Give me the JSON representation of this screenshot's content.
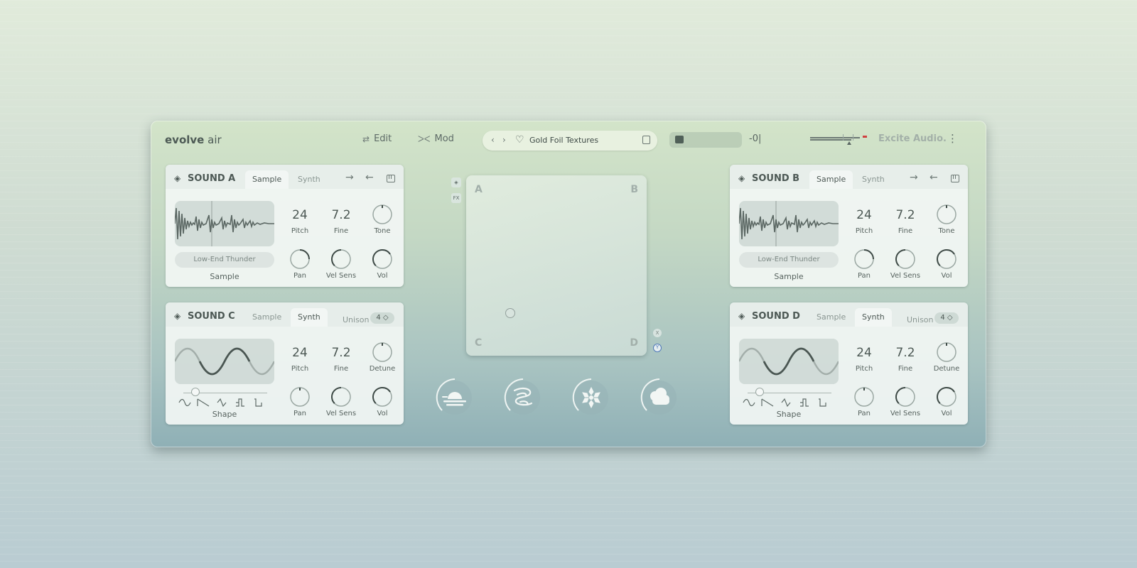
{
  "app": {
    "logo_bold": "evolve",
    "logo_light": " air",
    "nav": {
      "edit": "Edit",
      "mod": "Mod"
    },
    "preset_name": "Gold Foil Textures",
    "brand": "Excite Audio.",
    "menu_glyph": "⋮"
  },
  "panels": {
    "a": {
      "title": "SOUND A",
      "tab1": "Sample",
      "tab2": "Synth",
      "active": "tab1",
      "sample_name": "Low-End Thunder",
      "sample_label": "Sample",
      "pitch": "24",
      "pitch_label": "Pitch",
      "fine": "7.2",
      "fine_label": "Fine",
      "k3_label": "Tone",
      "pan_label": "Pan",
      "vel_label": "Vel Sens",
      "vol_label": "Vol"
    },
    "b": {
      "title": "SOUND B",
      "tab1": "Sample",
      "tab2": "Synth",
      "active": "tab1",
      "sample_name": "Low-End Thunder",
      "sample_label": "Sample",
      "pitch": "24",
      "pitch_label": "Pitch",
      "fine": "7.2",
      "fine_label": "Fine",
      "k3_label": "Tone",
      "pan_label": "Pan",
      "vel_label": "Vel Sens",
      "vol_label": "Vol"
    },
    "c": {
      "title": "SOUND C",
      "tab1": "Sample",
      "tab2": "Synth",
      "active": "tab2",
      "unison_label": "Unison",
      "unison_value": "4 ◇",
      "shape_label": "Shape",
      "pitch": "24",
      "pitch_label": "Pitch",
      "fine": "7.2",
      "fine_label": "Fine",
      "k3_label": "Detune",
      "pan_label": "Pan",
      "vel_label": "Vel Sens",
      "vol_label": "Vol"
    },
    "d": {
      "title": "SOUND D",
      "tab1": "Sample",
      "tab2": "Synth",
      "active": "tab2",
      "unison_label": "Unison",
      "unison_value": "4 ◇",
      "shape_label": "Shape",
      "pitch": "24",
      "pitch_label": "Pitch",
      "fine": "7.2",
      "fine_label": "Fine",
      "k3_label": "Detune",
      "pan_label": "Pan",
      "vel_label": "Vel Sens",
      "vol_label": "Vol"
    }
  },
  "xy_pad": {
    "corners": {
      "a": "A",
      "b": "B",
      "c": "C",
      "d": "D"
    },
    "side_fx": "FX",
    "axis_x": "X",
    "axis_y": "Y"
  },
  "fx_icons": [
    "sunrise-icon",
    "wind-swirl-icon",
    "snowflake-icon",
    "cloud-icon"
  ],
  "colors": {
    "accent_blue": "#4f79b8",
    "meter_red": "#d04040"
  }
}
